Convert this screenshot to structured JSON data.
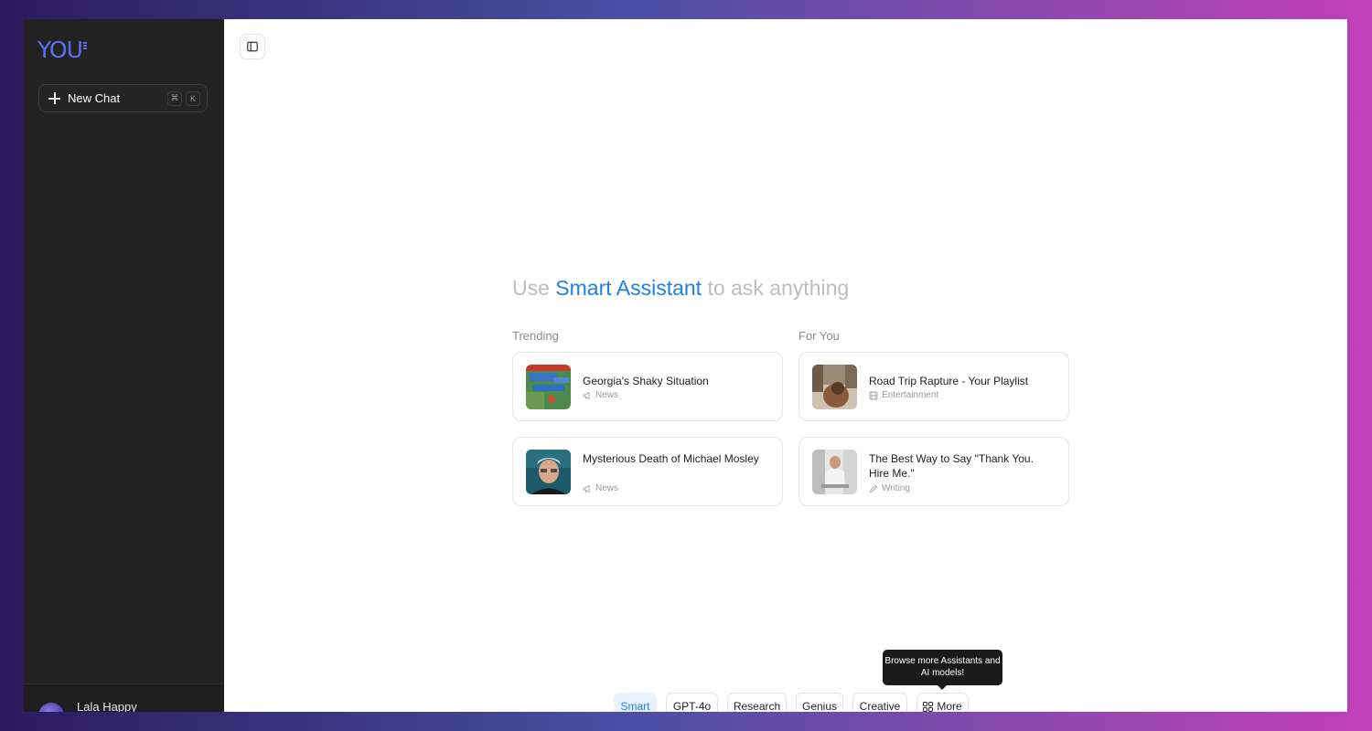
{
  "sidebar": {
    "logo": "YOU",
    "new_chat_label": "New Chat",
    "shortcut_keys": [
      "⌘",
      "K"
    ],
    "user_name": "Lala Happy"
  },
  "main": {
    "headline_prefix": "Use ",
    "headline_accent": "Smart Assistant",
    "headline_suffix": " to ask anything",
    "trending_title": "Trending",
    "for_you_title": "For You",
    "trending": [
      {
        "title": "Georgia's Shaky Situation",
        "category": "News",
        "icon": "megaphone-icon"
      },
      {
        "title": "Mysterious Death of Michael Mosley",
        "category": "News",
        "icon": "megaphone-icon"
      }
    ],
    "for_you": [
      {
        "title": "Road Trip Rapture - Your Playlist",
        "category": "Entertainment",
        "icon": "film-icon"
      },
      {
        "title": "The Best Way to Say \"Thank You. Hire Me.\"",
        "category": "Writing",
        "icon": "pencil-icon"
      }
    ]
  },
  "models": {
    "chips": [
      "Smart",
      "GPT-4o",
      "Research",
      "Genius",
      "Creative"
    ],
    "more_label": "More",
    "tooltip": "Browse more Assistants and AI models!"
  },
  "colors": {
    "accent": "#1f80e8",
    "sidebar_bg": "#222222",
    "logo": "#5b6ff0"
  }
}
